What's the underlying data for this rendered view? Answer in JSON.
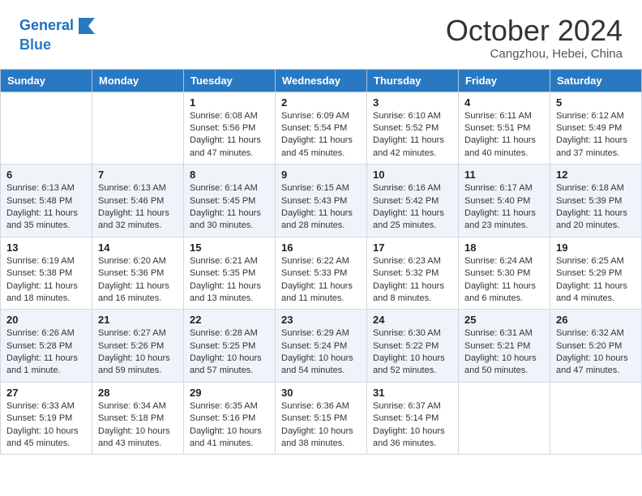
{
  "header": {
    "logo_line1": "General",
    "logo_line2": "Blue",
    "month_title": "October 2024",
    "location": "Cangzhou, Hebei, China"
  },
  "weekdays": [
    "Sunday",
    "Monday",
    "Tuesday",
    "Wednesday",
    "Thursday",
    "Friday",
    "Saturday"
  ],
  "weeks": [
    [
      {
        "day": "",
        "info": ""
      },
      {
        "day": "",
        "info": ""
      },
      {
        "day": "1",
        "info": "Sunrise: 6:08 AM\nSunset: 5:56 PM\nDaylight: 11 hours and 47 minutes."
      },
      {
        "day": "2",
        "info": "Sunrise: 6:09 AM\nSunset: 5:54 PM\nDaylight: 11 hours and 45 minutes."
      },
      {
        "day": "3",
        "info": "Sunrise: 6:10 AM\nSunset: 5:52 PM\nDaylight: 11 hours and 42 minutes."
      },
      {
        "day": "4",
        "info": "Sunrise: 6:11 AM\nSunset: 5:51 PM\nDaylight: 11 hours and 40 minutes."
      },
      {
        "day": "5",
        "info": "Sunrise: 6:12 AM\nSunset: 5:49 PM\nDaylight: 11 hours and 37 minutes."
      }
    ],
    [
      {
        "day": "6",
        "info": "Sunrise: 6:13 AM\nSunset: 5:48 PM\nDaylight: 11 hours and 35 minutes."
      },
      {
        "day": "7",
        "info": "Sunrise: 6:13 AM\nSunset: 5:46 PM\nDaylight: 11 hours and 32 minutes."
      },
      {
        "day": "8",
        "info": "Sunrise: 6:14 AM\nSunset: 5:45 PM\nDaylight: 11 hours and 30 minutes."
      },
      {
        "day": "9",
        "info": "Sunrise: 6:15 AM\nSunset: 5:43 PM\nDaylight: 11 hours and 28 minutes."
      },
      {
        "day": "10",
        "info": "Sunrise: 6:16 AM\nSunset: 5:42 PM\nDaylight: 11 hours and 25 minutes."
      },
      {
        "day": "11",
        "info": "Sunrise: 6:17 AM\nSunset: 5:40 PM\nDaylight: 11 hours and 23 minutes."
      },
      {
        "day": "12",
        "info": "Sunrise: 6:18 AM\nSunset: 5:39 PM\nDaylight: 11 hours and 20 minutes."
      }
    ],
    [
      {
        "day": "13",
        "info": "Sunrise: 6:19 AM\nSunset: 5:38 PM\nDaylight: 11 hours and 18 minutes."
      },
      {
        "day": "14",
        "info": "Sunrise: 6:20 AM\nSunset: 5:36 PM\nDaylight: 11 hours and 16 minutes."
      },
      {
        "day": "15",
        "info": "Sunrise: 6:21 AM\nSunset: 5:35 PM\nDaylight: 11 hours and 13 minutes."
      },
      {
        "day": "16",
        "info": "Sunrise: 6:22 AM\nSunset: 5:33 PM\nDaylight: 11 hours and 11 minutes."
      },
      {
        "day": "17",
        "info": "Sunrise: 6:23 AM\nSunset: 5:32 PM\nDaylight: 11 hours and 8 minutes."
      },
      {
        "day": "18",
        "info": "Sunrise: 6:24 AM\nSunset: 5:30 PM\nDaylight: 11 hours and 6 minutes."
      },
      {
        "day": "19",
        "info": "Sunrise: 6:25 AM\nSunset: 5:29 PM\nDaylight: 11 hours and 4 minutes."
      }
    ],
    [
      {
        "day": "20",
        "info": "Sunrise: 6:26 AM\nSunset: 5:28 PM\nDaylight: 11 hours and 1 minute."
      },
      {
        "day": "21",
        "info": "Sunrise: 6:27 AM\nSunset: 5:26 PM\nDaylight: 10 hours and 59 minutes."
      },
      {
        "day": "22",
        "info": "Sunrise: 6:28 AM\nSunset: 5:25 PM\nDaylight: 10 hours and 57 minutes."
      },
      {
        "day": "23",
        "info": "Sunrise: 6:29 AM\nSunset: 5:24 PM\nDaylight: 10 hours and 54 minutes."
      },
      {
        "day": "24",
        "info": "Sunrise: 6:30 AM\nSunset: 5:22 PM\nDaylight: 10 hours and 52 minutes."
      },
      {
        "day": "25",
        "info": "Sunrise: 6:31 AM\nSunset: 5:21 PM\nDaylight: 10 hours and 50 minutes."
      },
      {
        "day": "26",
        "info": "Sunrise: 6:32 AM\nSunset: 5:20 PM\nDaylight: 10 hours and 47 minutes."
      }
    ],
    [
      {
        "day": "27",
        "info": "Sunrise: 6:33 AM\nSunset: 5:19 PM\nDaylight: 10 hours and 45 minutes."
      },
      {
        "day": "28",
        "info": "Sunrise: 6:34 AM\nSunset: 5:18 PM\nDaylight: 10 hours and 43 minutes."
      },
      {
        "day": "29",
        "info": "Sunrise: 6:35 AM\nSunset: 5:16 PM\nDaylight: 10 hours and 41 minutes."
      },
      {
        "day": "30",
        "info": "Sunrise: 6:36 AM\nSunset: 5:15 PM\nDaylight: 10 hours and 38 minutes."
      },
      {
        "day": "31",
        "info": "Sunrise: 6:37 AM\nSunset: 5:14 PM\nDaylight: 10 hours and 36 minutes."
      },
      {
        "day": "",
        "info": ""
      },
      {
        "day": "",
        "info": ""
      }
    ]
  ]
}
